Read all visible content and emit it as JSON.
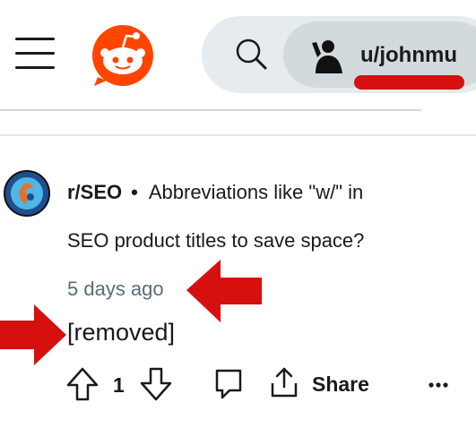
{
  "header": {
    "menu_icon": "hamburger-menu-icon",
    "logo_icon": "reddit-snoo-logo",
    "search_icon": "search-icon",
    "user": {
      "avatar_icon": "user-avatar-silhouette",
      "username": "u/johnmu"
    }
  },
  "post": {
    "subreddit": "r/SEO",
    "separator": "•",
    "title_line1": "Abbreviations like \"w/\" in",
    "title_line2": "SEO product titles to save space?",
    "time": "5 days ago",
    "body": "[removed]"
  },
  "actions": {
    "upvote_icon": "upvote-arrow-icon",
    "vote_count": "1",
    "downvote_icon": "downvote-arrow-icon",
    "comment_icon": "comment-bubble-icon",
    "share_icon": "share-icon",
    "share_label": "Share",
    "more_icon": "more-options-icon"
  },
  "colors": {
    "reddit_orange": "#ff4500",
    "annotation_red": "#d60f0f",
    "search_bg": "#e5ebee",
    "user_chip_bg": "#d2dadd",
    "muted_text": "#576f76"
  }
}
